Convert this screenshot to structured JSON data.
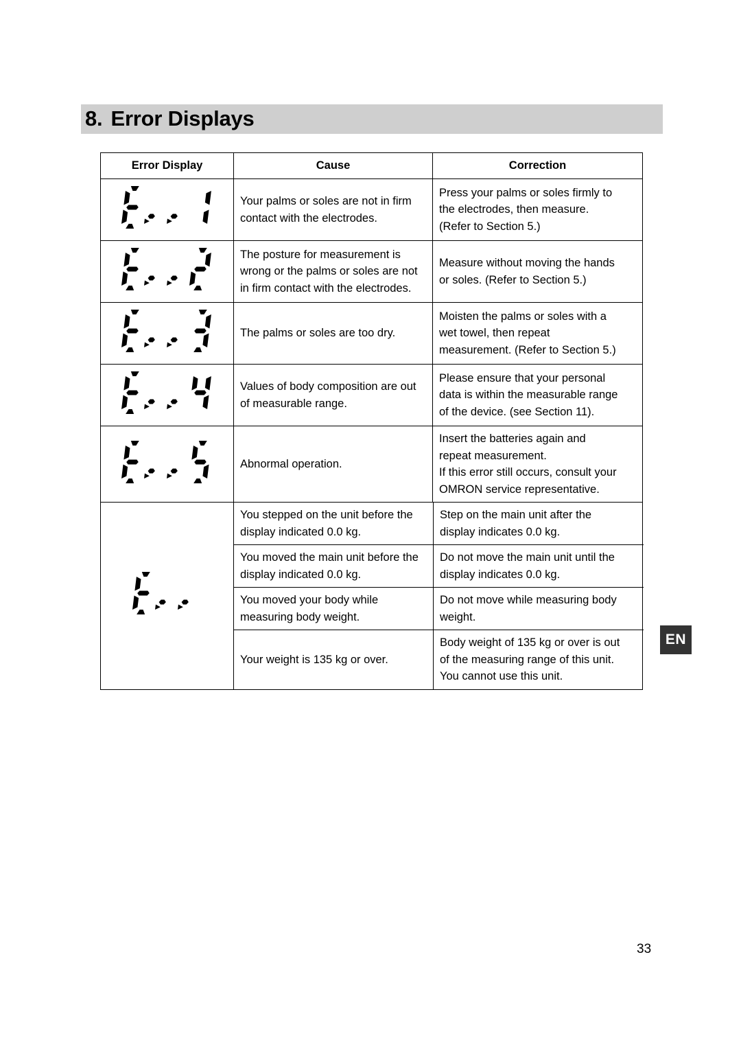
{
  "running_header": "",
  "section": {
    "number": "8.",
    "title": "Error Displays"
  },
  "side_tab": {
    "label": "EN"
  },
  "page_number": "33",
  "colors": {
    "band": "#cfcfcf",
    "tab_bg": "#333333",
    "tab_text": "#ffffff",
    "rule": "#000000"
  },
  "table": {
    "headers": {
      "display": "Error Display",
      "cause": "Cause",
      "correction": "Correction"
    },
    "rows": [
      {
        "display_code": "Err1",
        "display_segments": "E r r 1",
        "cause": [
          "Your palms or soles are not in firm",
          "contact with the electrodes."
        ],
        "correction": [
          "Press your palms or soles firmly to",
          "the electrodes, then measure.",
          "(Refer to Section 5.)"
        ]
      },
      {
        "display_code": "Err2",
        "display_segments": "E r r 2",
        "cause": [
          "The posture for measurement is",
          "wrong or the palms or soles are not",
          "in firm contact with the electrodes."
        ],
        "correction": [
          "Measure without moving the hands",
          "or soles. (Refer to Section 5.)"
        ]
      },
      {
        "display_code": "Err3",
        "display_segments": "E r r 3",
        "cause": [
          "The palms or soles are too dry."
        ],
        "correction": [
          "Moisten the palms or soles with a",
          "wet towel, then repeat",
          "measurement. (Refer to Section 5.)"
        ]
      },
      {
        "display_code": "Err4",
        "display_segments": "E r r 4",
        "cause": [
          "Values of body composition are out",
          "of measurable range."
        ],
        "correction": [
          "Please ensure that your personal",
          "data is within the measurable range",
          "of the device. (see Section 11)."
        ]
      },
      {
        "display_code": "Err5",
        "display_segments": "E r r 5",
        "cause": [
          "Abnormal operation."
        ],
        "correction": [
          "Insert the batteries again and",
          "repeat measurement.",
          "If this error still occurs, consult your",
          "OMRON service representative."
        ]
      }
    ],
    "group_row": {
      "display_code": "Err",
      "display_segments": "E r r",
      "subrows": [
        {
          "cause": [
            "You stepped on the unit before the",
            "display indicated 0.0 kg."
          ],
          "correction": [
            "Step on the main unit after the",
            "display indicates 0.0 kg."
          ]
        },
        {
          "cause": [
            "You moved the main unit before the",
            "display indicated 0.0 kg."
          ],
          "correction": [
            "Do not move the main unit until the",
            "display indicates 0.0 kg."
          ]
        },
        {
          "cause": [
            "You moved your body while",
            "measuring body weight."
          ],
          "correction": [
            "Do not move while measuring body",
            "weight."
          ]
        },
        {
          "cause": [
            "Your weight is 135 kg or over."
          ],
          "correction": [
            "Body weight of 135 kg or over is out",
            "of the measuring range of this unit.",
            "You cannot use this unit."
          ]
        }
      ]
    }
  }
}
